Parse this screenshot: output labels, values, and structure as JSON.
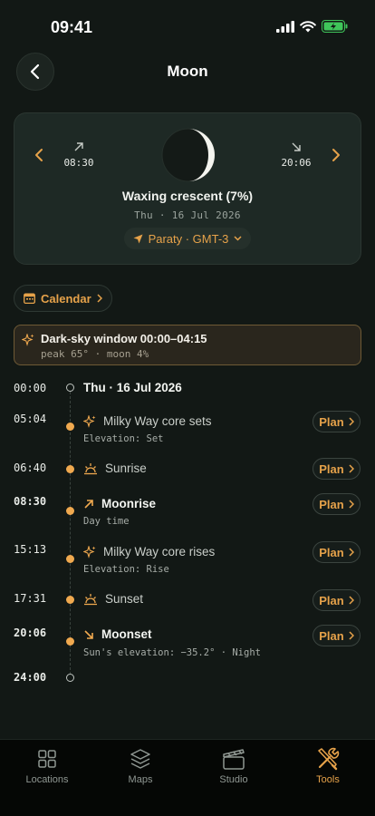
{
  "status": {
    "time": "09:41"
  },
  "header": {
    "title": "Moon"
  },
  "moon_card": {
    "rise_time": "08:30",
    "set_time": "20:06",
    "phase": "Waxing crescent (7%)",
    "date": "Thu · 16 Jul 2026",
    "location": "Paraty · GMT-3"
  },
  "calendar_label": "Calendar",
  "dark_sky": {
    "title": "Dark-sky window 00:00–04:15",
    "subtitle": "peak 65° · moon 4%"
  },
  "plan_label": "Plan",
  "timeline": {
    "start_time": "00:00",
    "start_label": "Thu · 16 Jul 2026",
    "end_time": "24:00",
    "events": [
      {
        "time": "05:04",
        "title": "Milky Way core sets",
        "subtitle": "Elevation: Set",
        "icon": "sparkle-icon"
      },
      {
        "time": "06:40",
        "title": "Sunrise",
        "subtitle": "",
        "icon": "sunrise-icon"
      },
      {
        "time": "08:30",
        "title": "Moonrise",
        "subtitle": "Day time",
        "icon": "arrow-up-right-icon"
      },
      {
        "time": "15:13",
        "title": "Milky Way core rises",
        "subtitle": "Elevation: Rise",
        "icon": "sparkle-icon"
      },
      {
        "time": "17:31",
        "title": "Sunset",
        "subtitle": "",
        "icon": "sunset-icon"
      },
      {
        "time": "20:06",
        "title": "Moonset",
        "subtitle": "Sun's elevation: −35.2° · Night",
        "icon": "arrow-down-right-icon"
      }
    ]
  },
  "tabs": [
    {
      "label": "Locations",
      "icon": "grid-icon",
      "active": false
    },
    {
      "label": "Maps",
      "icon": "layers-icon",
      "active": false
    },
    {
      "label": "Studio",
      "icon": "clapperboard-icon",
      "active": false
    },
    {
      "label": "Tools",
      "icon": "tools-icon",
      "active": true
    }
  ],
  "colors": {
    "accent": "#e6a24a",
    "background": "#121815",
    "card": "#1e2925"
  }
}
